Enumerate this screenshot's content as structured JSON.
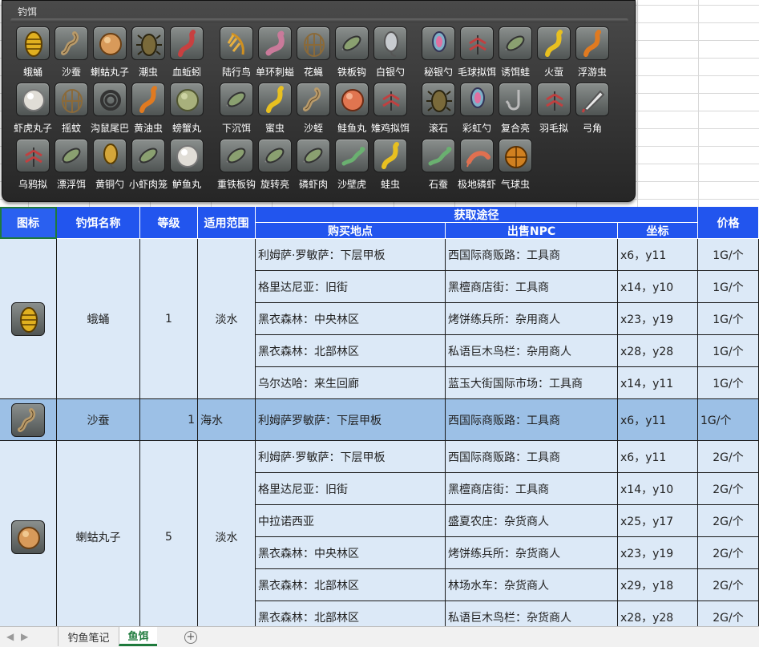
{
  "panel": {
    "title": "钓饵",
    "rows": [
      [
        "蛾蛹",
        "沙蚕",
        "蝲蛄丸子",
        "潮虫",
        "血蚯蚓",
        "",
        "陆行鸟",
        "单环刺螠",
        "花蝇",
        "铁板钩",
        "白银勺",
        "",
        "秘银勺",
        "毛球拟饵",
        "诱饵蛙",
        "火萤",
        "浮游虫"
      ],
      [
        "虾虎丸子",
        "摇蚊",
        "沟鼠尾巴",
        "黄油虫",
        "螃蟹丸",
        "",
        "下沉饵",
        "蜜虫",
        "沙蛭",
        "鲑鱼丸",
        "雉鸡拟饵",
        "",
        "滚石",
        "彩虹勺",
        "复合亮",
        "羽毛拟",
        "弓角"
      ],
      [
        "乌鸦拟",
        "漂浮饵",
        "黄铜勺",
        "小虾肉笼",
        "鲈鱼丸",
        "",
        "重铁板钩",
        "旋转亮",
        "磷虾肉",
        "沙壁虎",
        "蛙虫",
        "",
        "石蚕",
        "极地磷虾",
        "气球虫",
        "",
        ""
      ]
    ]
  },
  "table": {
    "headers": {
      "icon": "图标",
      "name": "钓饵名称",
      "level": "等级",
      "range": "适用范围",
      "obtain": "获取途径",
      "shop": "购买地点",
      "npc": "出售NPC",
      "coord": "坐标",
      "price": "价格"
    },
    "groups": [
      {
        "name": "蛾蛹",
        "level": "1",
        "range": "淡水",
        "icon": "moth-pupa-icon",
        "rows": [
          {
            "shop": "利姆萨·罗敏萨：下层甲板",
            "npc": "西国际商贩路：工具商",
            "coord": "x6，y11",
            "price": "1G/个"
          },
          {
            "shop": "格里达尼亚：旧街",
            "npc": "黑檀商店街：工具商",
            "coord": "x14，y10",
            "price": "1G/个"
          },
          {
            "shop": "黑衣森林：中央林区",
            "npc": "烤饼练兵所：杂用商人",
            "coord": "x23，y19",
            "price": "1G/个"
          },
          {
            "shop": "黑衣森林：北部林区",
            "npc": "私语巨木鸟栏：杂用商人",
            "coord": "x28，y28",
            "price": "1G/个"
          },
          {
            "shop": "乌尔达哈：来生回廊",
            "npc": "蓝玉大街国际市场：工具商",
            "coord": "x14，y11",
            "price": "1G/个"
          }
        ]
      },
      {
        "name": "沙蚕",
        "level": "1",
        "range": "海水",
        "icon": "sandworm-icon",
        "highlight": true,
        "rows": [
          {
            "shop": "利姆萨罗敏萨：下层甲板",
            "npc": "西国际商贩路：工具商",
            "coord": "x6，y11",
            "price": "1G/个"
          }
        ]
      },
      {
        "name": "蝲蛄丸子",
        "level": "5",
        "range": "淡水",
        "icon": "crayfish-ball-icon",
        "rows": [
          {
            "shop": "利姆萨·罗敏萨：下层甲板",
            "npc": "西国际商贩路：工具商",
            "coord": "x6，y11",
            "price": "2G/个"
          },
          {
            "shop": "格里达尼亚：旧街",
            "npc": "黑檀商店街：工具商",
            "coord": "x14，y10",
            "price": "2G/个"
          },
          {
            "shop": "中拉诺西亚",
            "npc": "盛夏农庄：杂货商人",
            "coord": "x25，y17",
            "price": "2G/个"
          },
          {
            "shop": "黑衣森林：中央林区",
            "npc": "烤饼练兵所：杂货商人",
            "coord": "x23，y19",
            "price": "2G/个"
          },
          {
            "shop": "黑衣森林：北部林区",
            "npc": "林场水车：杂货商人",
            "coord": "x29，y18",
            "price": "2G/个"
          },
          {
            "shop": "黑衣森林：北部林区",
            "npc": "私语巨木鸟栏：杂货商人",
            "coord": "x28，y28",
            "price": "2G/个"
          }
        ]
      }
    ]
  },
  "sheets": {
    "tabs": [
      "钓鱼笔记",
      "鱼饵"
    ],
    "active": "鱼饵",
    "add": "+"
  }
}
